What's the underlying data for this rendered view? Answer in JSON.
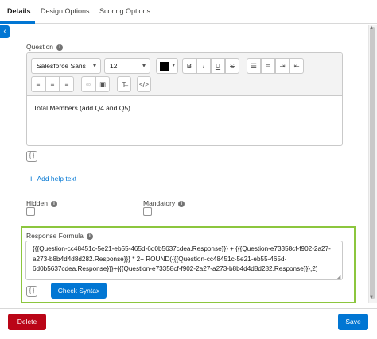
{
  "tabs": [
    {
      "label": "Details"
    },
    {
      "label": "Design Options"
    },
    {
      "label": "Scoring Options"
    }
  ],
  "question": {
    "label": "Question",
    "font_family": "Salesforce Sans",
    "font_size": "12",
    "text_color": "#000000",
    "content": "Total Members (add Q4 and Q5)"
  },
  "toolbar": {
    "bold": "B",
    "italic": "I",
    "underline": "U",
    "strike": "S"
  },
  "help": {
    "add_label": "Add help text"
  },
  "hidden": {
    "label": "Hidden",
    "checked": false
  },
  "mandatory": {
    "label": "Mandatory",
    "checked": false
  },
  "formula": {
    "label": "Response Formula",
    "value": "{{{Question-cc48451c-5e21-eb55-465d-6d0b5637cdea.Response}}} + {{{Question-e73358cf-f902-2a27-a273-b8b4d4d8d282.Response}}} * 2+ ROUND({{{Question-cc48451c-5e21-eb55-465d-6d0b5637cdea.Response}}}+{{{Question-e73358cf-f902-2a27-a273-b8b4d4d8d282.Response}}},2)",
    "check_syntax_label": "Check Syntax"
  },
  "footer": {
    "delete_label": "Delete",
    "save_label": "Save"
  },
  "colors": {
    "accent": "#0176d3",
    "danger": "#ba0517",
    "highlight": "#8cc63e"
  }
}
